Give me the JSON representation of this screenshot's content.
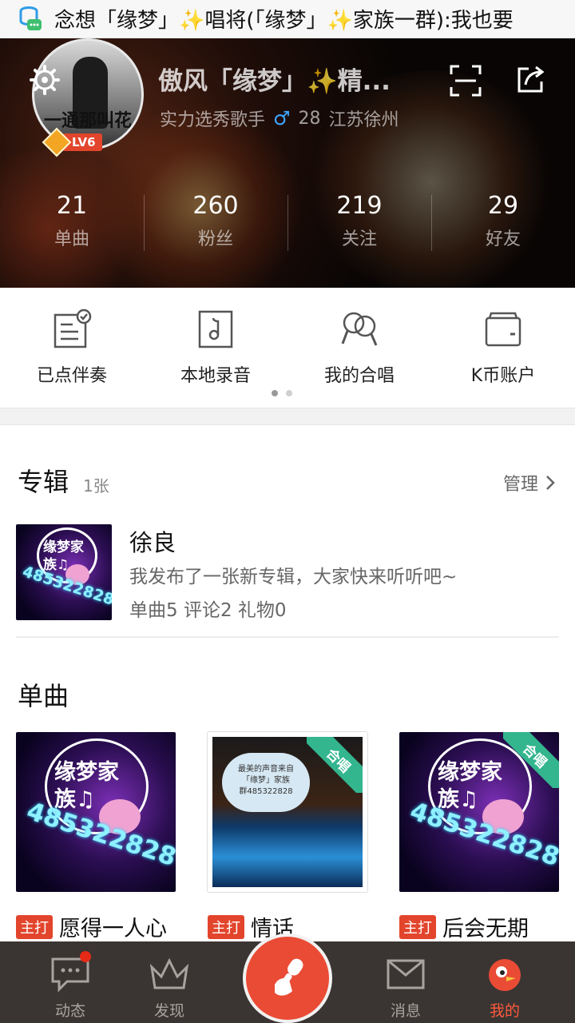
{
  "statusbar": {
    "notification": "念想「缘梦」✨唱将(「缘梦」✨家族一群):我也要"
  },
  "profile": {
    "name": "傲风「缘梦」✨精...",
    "subtitle": "实力选秀歌手",
    "age": "28",
    "location": "江苏徐州",
    "level": "LV6",
    "avatar_caption": "一通那叫花"
  },
  "stats": [
    {
      "num": "21",
      "label": "单曲"
    },
    {
      "num": "260",
      "label": "粉丝"
    },
    {
      "num": "219",
      "label": "关注"
    },
    {
      "num": "29",
      "label": "好友"
    }
  ],
  "shortcuts": [
    {
      "label": "已点伴奏",
      "icon": "checklist-icon"
    },
    {
      "label": "本地录音",
      "icon": "music-note-icon"
    },
    {
      "label": "我的合唱",
      "icon": "duet-icon"
    },
    {
      "label": "K币账户",
      "icon": "wallet-icon"
    }
  ],
  "album_section": {
    "title": "专辑",
    "count": "1张",
    "manage": "管理"
  },
  "album": {
    "name": "徐良",
    "desc": "我发布了一张新专辑，大家快来听听吧~",
    "stats": "单曲5 评论2 礼物0",
    "cover_text_1": "缘梦家",
    "cover_text_2": "族♫",
    "cover_number": "485322828"
  },
  "singles_section": {
    "title": "单曲"
  },
  "singles": [
    {
      "badge": "主打",
      "name": "愿得一人心",
      "cover_text_1": "缘梦家",
      "cover_text_2": "族♫",
      "cover_number": "485322828"
    },
    {
      "badge": "主打",
      "name": "情话",
      "ribbon": "合唱",
      "cloud_1": "最美的声音来自",
      "cloud_2": "「缘梦」家族",
      "cloud_3": "群485322828"
    },
    {
      "badge": "主打",
      "name": "后会无期",
      "ribbon": "合唱",
      "cover_text_1": "缘梦家",
      "cover_text_2": "族♫",
      "cover_number": "485322828"
    }
  ],
  "bottom_nav": [
    {
      "label": "动态"
    },
    {
      "label": "发现"
    },
    {
      "label": "消息"
    },
    {
      "label": "我的"
    }
  ],
  "colors": {
    "accent": "#ea4b35",
    "nav_bg": "#3a3532",
    "duet_ribbon": "#33b58e"
  }
}
